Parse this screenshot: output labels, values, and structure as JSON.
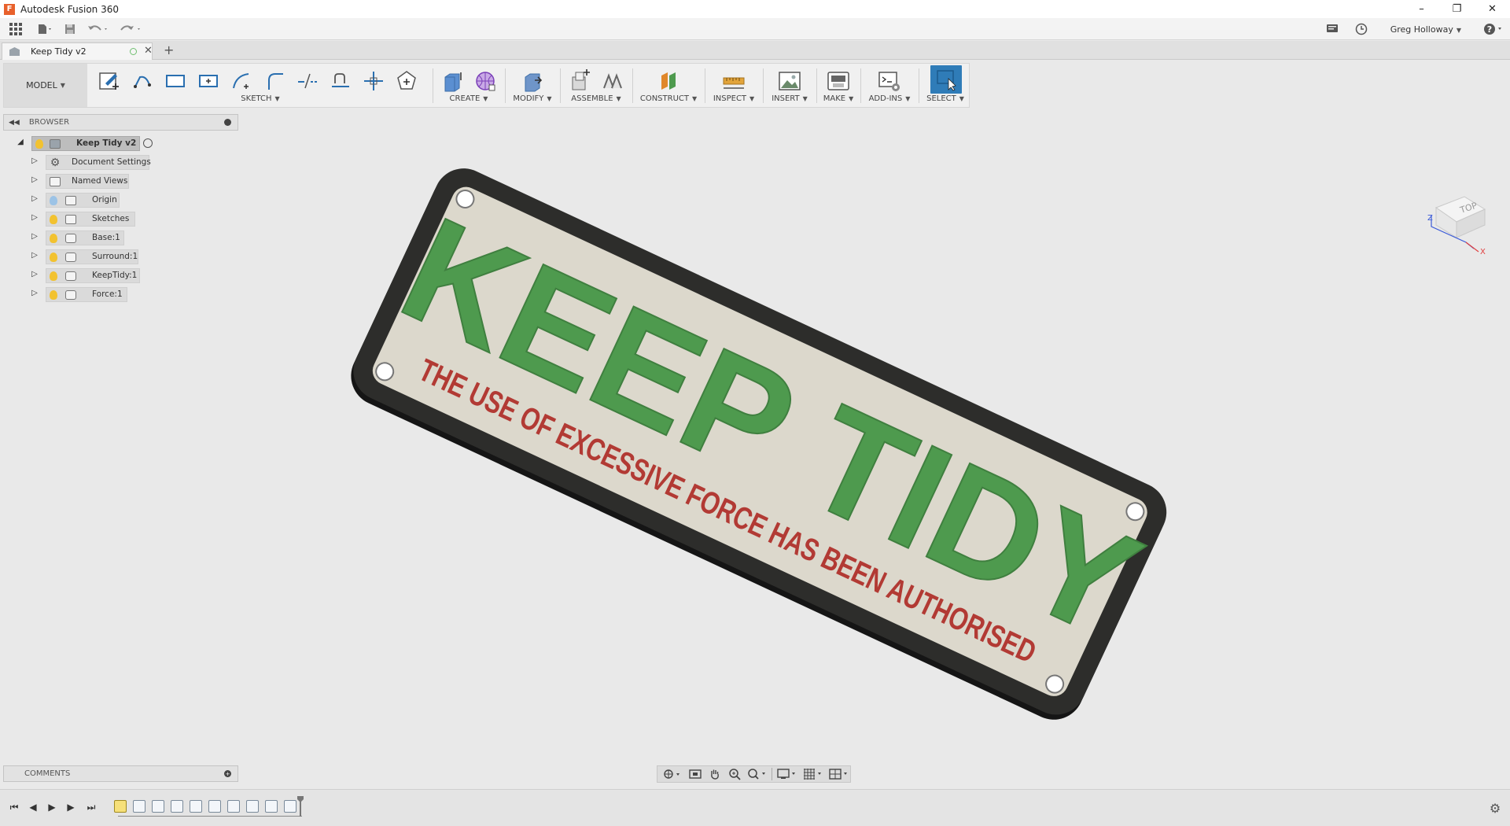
{
  "window": {
    "title": "Autodesk Fusion 360",
    "app_icon_letter": "F",
    "minimize": "–",
    "restore": "❐",
    "close": "✕"
  },
  "quick_access": {
    "user": "Greg Holloway"
  },
  "doc_tab": {
    "label": "Keep Tidy v2",
    "close": "✕",
    "new_tab": "+"
  },
  "toolbar": {
    "workspace": "MODEL",
    "groups": {
      "sketch": "SKETCH",
      "create": "CREATE",
      "modify": "MODIFY",
      "assemble": "ASSEMBLE",
      "construct": "CONSTRUCT",
      "inspect": "INSPECT",
      "insert": "INSERT",
      "make": "MAKE",
      "addins": "ADD-INS",
      "select": "SELECT"
    }
  },
  "browser": {
    "title": "BROWSER",
    "root": "Keep Tidy v2",
    "items": [
      {
        "label": "Document Settings"
      },
      {
        "label": "Named Views"
      },
      {
        "label": "Origin"
      },
      {
        "label": "Sketches"
      },
      {
        "label": "Base:1"
      },
      {
        "label": "Surround:1"
      },
      {
        "label": "KeepTidy:1"
      },
      {
        "label": "Force:1"
      }
    ]
  },
  "model": {
    "main_text": "KEEP TIDY",
    "sub_text": "THE USE OF EXCESSIVE FORCE HAS BEEN AUTHORISED",
    "colors": {
      "plate": "#dcd8cc",
      "frame": "#2d2d2b",
      "main_text": "#4e9a4e",
      "sub_text": "#b23a34"
    }
  },
  "viewcube": {
    "face": "TOP",
    "axis_x": "X",
    "axis_z": "Z"
  },
  "comments": {
    "title": "COMMENTS"
  },
  "colors": {
    "accent": "#2f7cb8",
    "bulb_on": "#f2c230",
    "bulb_off": "#9cc3e6"
  }
}
